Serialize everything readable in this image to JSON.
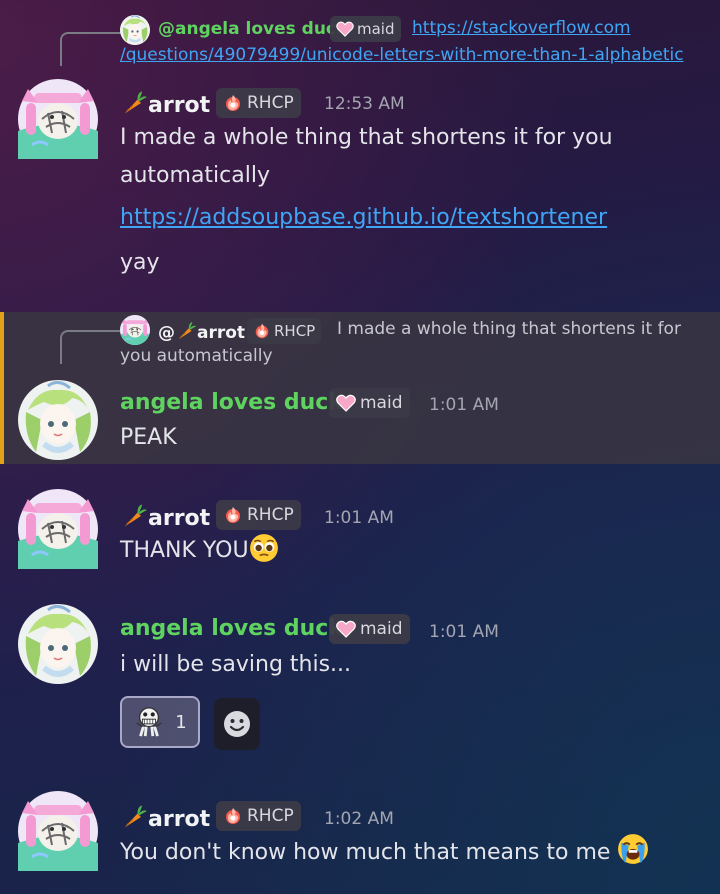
{
  "messages": {
    "m1": {
      "reply": {
        "name": "@angela loves duck",
        "tag": "maid",
        "text_line1": "https://stackoverflow.com",
        "text_line2": "/questions/49079499/unicode-letters-with-more-than-1-alphabetic"
      },
      "author": "arrot",
      "tag": "RHCP",
      "time": "12:53 AM",
      "line1": "I made a whole thing that shortens it for you",
      "line2": "automatically",
      "link": "https://addsoupbase.github.io/textshortener",
      "line3": "yay"
    },
    "m2": {
      "reply": {
        "name_prefix": "@",
        "name": "arrot",
        "tag": "RHCP",
        "text_line1": "I made a whole thing that shortens it for",
        "text_line2": "you automatically"
      },
      "author": "angela loves duck",
      "tag": "maid",
      "time": "1:01 AM",
      "line1": "PEAK"
    },
    "m3": {
      "author": "arrot",
      "tag": "RHCP",
      "time": "1:01 AM",
      "line1": "THANK YOU"
    },
    "m4": {
      "author": "angela loves duck",
      "tag": "maid",
      "time": "1:01 AM",
      "line1": "i will be saving this...",
      "reaction_count": "1"
    },
    "m5": {
      "author": "arrot",
      "tag": "RHCP",
      "time": "1:02 AM",
      "line1": "You don't know how much that means to me"
    }
  },
  "icons": {
    "carrot": "carrot-icon",
    "rhcp": "fire-flower-icon",
    "maid": "pink-heart-icon",
    "pleading": "pleading-face-icon",
    "crying": "loudly-crying-face-icon",
    "reaction": "skull-creature-icon",
    "add_reaction": "add-reaction-icon"
  },
  "colors": {
    "link": "#3fa5f5",
    "angela_name": "#5fd35f",
    "highlight_bar": "#e3a21a"
  }
}
